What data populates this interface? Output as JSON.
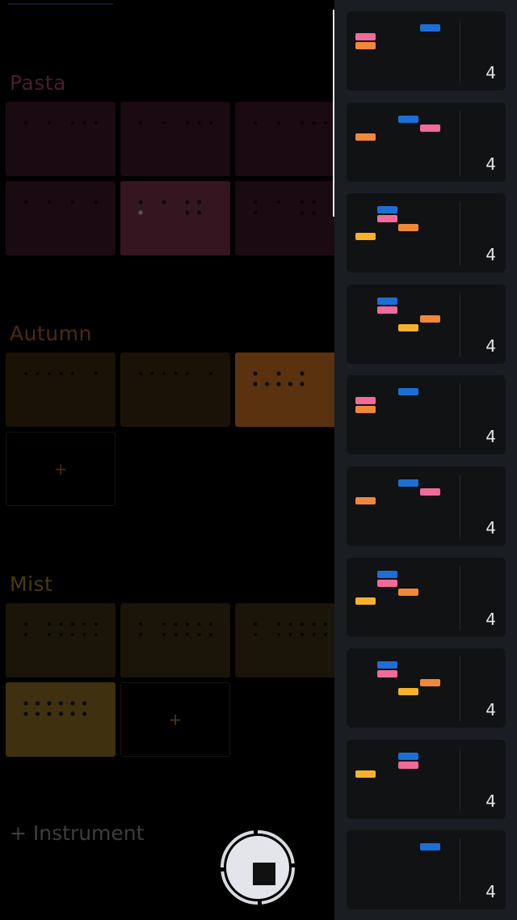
{
  "colors": {
    "background": "#000000",
    "drawer": "#1a1d22",
    "card": "#111214",
    "note_blue": "#1c6fd6",
    "note_pink": "#f06a9a",
    "note_orange": "#f0883a",
    "note_yellow": "#f6b22a"
  },
  "sections": [
    {
      "name": "Pasta",
      "color": "#4a1e2c",
      "tile_bg": "#1a0a11",
      "active_bg": "#351620",
      "add_tile": false,
      "tiles": [
        {
          "active": false,
          "rows": [
            [
              1,
              0,
              1,
              0,
              1,
              1,
              1
            ]
          ]
        },
        {
          "active": false,
          "rows": [
            [
              1,
              0,
              1,
              0,
              1,
              1,
              1
            ]
          ]
        },
        {
          "active": false,
          "rows": [
            [
              1,
              0,
              1,
              0,
              1,
              1,
              1
            ]
          ]
        },
        {
          "active": false,
          "rows": [
            [
              1,
              0,
              1,
              0,
              1,
              0,
              1
            ]
          ]
        },
        {
          "active": true,
          "rows": [
            [
              1,
              0,
              1,
              0,
              1,
              1,
              0
            ],
            [
              1,
              0,
              0,
              0,
              1,
              1,
              0
            ]
          ]
        },
        {
          "active": false,
          "rows": [
            [
              1,
              0,
              1,
              0,
              1,
              1,
              0
            ],
            [
              1,
              0,
              0,
              0,
              1,
              1,
              0
            ]
          ]
        }
      ]
    },
    {
      "name": "Autumn",
      "color": "#4a2c10",
      "tile_bg": "#1a1206",
      "active_bg": "#5a3210",
      "add_tile": true,
      "add_label": "+",
      "tiles": [
        {
          "active": false,
          "rows": [
            [
              1,
              1,
              1,
              1,
              1,
              0,
              1
            ]
          ]
        },
        {
          "active": false,
          "rows": [
            [
              1,
              1,
              1,
              1,
              1,
              0,
              1
            ]
          ]
        },
        {
          "active": true,
          "rows": [
            [
              1,
              0,
              1,
              0,
              1,
              0,
              0
            ],
            [
              1,
              1,
              1,
              1,
              1,
              0,
              0
            ]
          ]
        }
      ]
    },
    {
      "name": "Mist",
      "color": "#4a3a14",
      "tile_bg": "#1a1508",
      "active_bg": "#3f3010",
      "add_tile": true,
      "add_label": "+",
      "tiles": [
        {
          "active": false,
          "rows": [
            [
              1,
              0,
              1,
              1,
              1,
              1,
              1
            ],
            [
              1,
              0,
              1,
              1,
              1,
              1,
              1
            ]
          ]
        },
        {
          "active": false,
          "rows": [
            [
              1,
              0,
              1,
              1,
              1,
              1,
              1
            ],
            [
              1,
              0,
              1,
              1,
              1,
              1,
              1
            ]
          ]
        },
        {
          "active": false,
          "rows": [
            [
              1,
              0,
              1,
              1,
              1,
              1,
              1
            ],
            [
              1,
              0,
              1,
              1,
              1,
              1,
              1
            ]
          ]
        },
        {
          "active": true,
          "rows": [
            [
              1,
              1,
              1,
              1,
              1,
              1,
              0
            ],
            [
              1,
              1,
              1,
              1,
              1,
              1,
              0
            ]
          ]
        }
      ]
    }
  ],
  "add_instrument_label": "+ Instrument",
  "patterns": [
    {
      "count": "4",
      "notes": [
        [
          "blue",
          3,
          0
        ],
        [
          "pink",
          0,
          1
        ],
        [
          "orange",
          0,
          2
        ]
      ]
    },
    {
      "count": "4",
      "notes": [
        [
          "blue",
          2,
          0
        ],
        [
          "pink",
          3,
          1
        ],
        [
          "orange",
          0,
          2
        ]
      ]
    },
    {
      "count": "4",
      "notes": [
        [
          "blue",
          1,
          0
        ],
        [
          "pink",
          1,
          1
        ],
        [
          "orange",
          2,
          2
        ],
        [
          "yellow",
          0,
          3
        ]
      ]
    },
    {
      "count": "4",
      "notes": [
        [
          "blue",
          1,
          0
        ],
        [
          "pink",
          1,
          1
        ],
        [
          "orange",
          3,
          2
        ],
        [
          "yellow",
          2,
          3
        ]
      ]
    },
    {
      "count": "4",
      "notes": [
        [
          "blue",
          2,
          0
        ],
        [
          "pink",
          0,
          1
        ],
        [
          "orange",
          0,
          2
        ]
      ]
    },
    {
      "count": "4",
      "notes": [
        [
          "blue",
          2,
          0
        ],
        [
          "pink",
          3,
          1
        ],
        [
          "orange",
          0,
          2
        ]
      ]
    },
    {
      "count": "4",
      "notes": [
        [
          "blue",
          1,
          0
        ],
        [
          "pink",
          1,
          1
        ],
        [
          "orange",
          2,
          2
        ],
        [
          "yellow",
          0,
          3
        ]
      ]
    },
    {
      "count": "4",
      "notes": [
        [
          "blue",
          1,
          0
        ],
        [
          "pink",
          1,
          1
        ],
        [
          "orange",
          3,
          2
        ],
        [
          "yellow",
          2,
          3
        ]
      ]
    },
    {
      "count": "4",
      "notes": [
        [
          "blue",
          2,
          0
        ],
        [
          "pink",
          2,
          1
        ],
        [
          "yellow",
          0,
          2
        ]
      ]
    },
    {
      "count": "4",
      "notes": [
        [
          "blue",
          3,
          0
        ]
      ]
    }
  ]
}
